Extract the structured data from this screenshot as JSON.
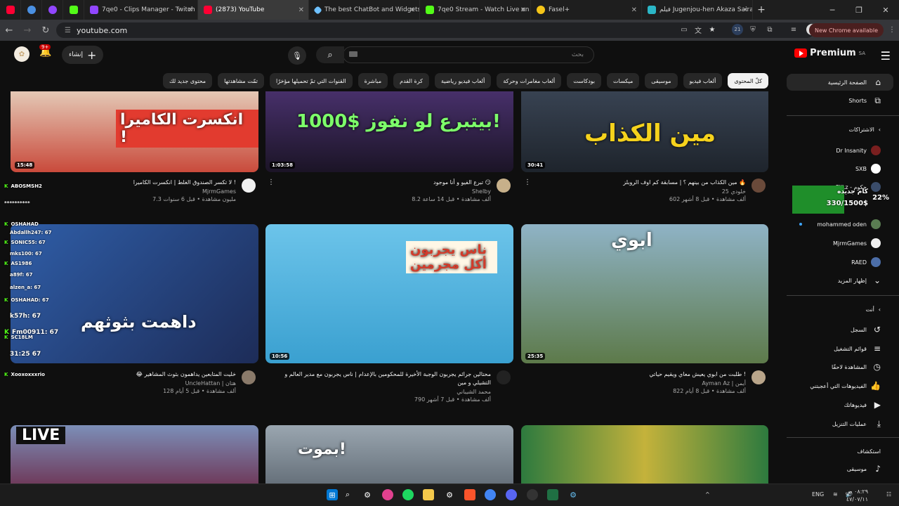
{
  "browser": {
    "tabs": [
      {
        "label": "",
        "icon": "youtube-icon",
        "color": "#ff0033"
      },
      {
        "label": "",
        "icon": "circle-icon",
        "color": "#4a90e2"
      },
      {
        "label": "",
        "icon": "twitch-icon",
        "color": "#9146ff"
      },
      {
        "label": "",
        "icon": "extension-icon",
        "color": "#53fc18"
      },
      {
        "label": "7qe0 - Clips Manager - Twitch",
        "icon": "twitch-icon",
        "color": "#9146ff"
      },
      {
        "label": "(2873) YouTube",
        "icon": "youtube-icon",
        "color": "#ff0033"
      },
      {
        "label": "The best ChatBot and Widgets",
        "icon": "diamond-icon",
        "color": "#6ec1ff"
      },
      {
        "label": "7qe0 Stream - Watch Live on Kick",
        "icon": "kick-icon",
        "color": "#53fc18"
      },
      {
        "label": "Fasel+",
        "icon": "lightbulb-icon",
        "color": "#f5c518"
      },
      {
        "label": "فيلم Jugenjou-hen Akaza Sairai",
        "icon": "play-icon",
        "color": "#2bb6c6"
      }
    ],
    "url": "youtube.com",
    "new_chrome": "New Chrome available",
    "ext_badge": "21"
  },
  "youtube": {
    "logo": "Premium",
    "region": "SA",
    "search_placeholder": "بحث",
    "create_label": "إنشاء",
    "notif_badge": "9+",
    "chips": [
      "كلّ المحتوى",
      "ألعاب فيديو",
      "موسيقى",
      "ميكسات",
      "بودكاست",
      "ألعاب مغامرات وحركة",
      "ألعاب فيديو رياضية",
      "كرة القدم",
      "مباشرة",
      "القنوات التي تمّ تحميلها مؤخرًا",
      "تمّت مشاهدتها",
      "محتوى جديد لك"
    ],
    "sidebar": {
      "home": "الصفحة الرئيسية",
      "shorts": "Shorts",
      "subs_header": "الاشتراكات",
      "subs": [
        {
          "name": "Dr Insanity",
          "color": "#7a1f1f"
        },
        {
          "name": "SXB",
          "color": "#ffffff"
        },
        {
          "name": "oPiiLz - حكوم",
          "color": "#3a4c6a"
        },
        {
          "name": "mohammed oden",
          "color": "#5a7d52"
        },
        {
          "name": "MjrmGames",
          "color": "#f1f1f1"
        },
        {
          "name": "RAED",
          "color": "#4c6ea8"
        }
      ],
      "show_more": "إظهار المزيد",
      "you_header": "أنت",
      "you": [
        {
          "label": "السجل",
          "icon": "history-icon"
        },
        {
          "label": "قوائم التشغيل",
          "icon": "playlist-icon"
        },
        {
          "label": "المشاهدة لاحقًا",
          "icon": "clock-icon"
        },
        {
          "label": "الفيديوهات التي أعجبتني",
          "icon": "thumbs-up-icon"
        },
        {
          "label": "فيديوهاتك",
          "icon": "video-icon"
        },
        {
          "label": "عمليات التنزيل",
          "icon": "download-icon"
        }
      ],
      "explore_header": "استكشاف",
      "explore": [
        {
          "label": "موسيقى",
          "icon": "music-icon"
        }
      ]
    },
    "videos": [
      {
        "title": "لا تكسر الصندوق الغلط | انكسرت الكاميرا !",
        "channel": "MjrmGames",
        "stats": "7.3 مليون مشاهدة • قبل 6 سنوات",
        "duration": "15:48",
        "thumb_text": "انكسرت الكاميرا !",
        "bg": "#c94a3b"
      },
      {
        "title": "تبرع الفيو و أنا موجود 😏",
        "channel": "Shelby",
        "stats": "8.2 ألف مشاهدة • قبل 14 ساعة",
        "duration": "1:03:58",
        "thumb_text": "1000$ بيتبرع لو نفوز!",
        "bg": "#3a2a55"
      },
      {
        "title": "مين الكذاب من بينهم ؟ | مسابقة كم اوف الروبلز 🔥",
        "channel": "خلودي 25",
        "stats": "602 ألف مشاهدة • قبل 8 أشهر",
        "duration": "30:41",
        "thumb_text": "مين الكذاب",
        "bg": "#2b3440"
      },
      {
        "title": "😂 خليت المتابعين يداهمون بثوث المشاهير",
        "channel": "UncleHattan | هتان",
        "stats": "128 ألف مشاهدة • قبل 5 أيام",
        "duration": "",
        "thumb_text": "داهمت بثوثهم",
        "bg": "#2f5ea8"
      },
      {
        "title": "محتالين جرائم يجربون الوجبة الأخيرة للمحكومين بالإعدام | ناس يجربون مع مدير العالم و التشيلي و مين",
        "channel": "محمد الشيباني",
        "stats": "790 ألف مشاهدة • قبل 7 أشهر",
        "duration": "10:56",
        "thumb_text": "ناس يجربون أكل مجرمين",
        "bg": "#5ab5e0"
      },
      {
        "title": "طلبت من ابوي يعيش معاي ويقيم حياتي !",
        "channel": "Ayman Az | أيمن",
        "stats": "822 ألف مشاهدة • قبل 8 أيام",
        "duration": "25:35",
        "thumb_text": "ابوي",
        "bg": "#5d7a4a"
      },
      {
        "title": "",
        "channel": "",
        "stats": "",
        "duration": "",
        "thumb_text": "LIVE",
        "bg": "#6c2b4a"
      },
      {
        "title": "",
        "channel": "",
        "stats": "",
        "duration": "",
        "thumb_text": "بموت!",
        "bg": "#6f7b86"
      },
      {
        "title": "",
        "channel": "",
        "stats": "",
        "duration": "",
        "thumb_text": "",
        "bg": "#2d7a3e"
      }
    ],
    "chat": [
      {
        "user": "ABOSMSH2",
        "msg": ""
      },
      {
        "user": "**********",
        "msg": ""
      },
      {
        "user": "OSHAHAD",
        "msg": ""
      },
      {
        "user": "Abdallh247:",
        "msg": "67"
      },
      {
        "user": "SONIC55:",
        "msg": "67"
      },
      {
        "user": "mks100:",
        "msg": "67"
      },
      {
        "user": "AS1986",
        "msg": ""
      },
      {
        "user": "a89f:",
        "msg": "67"
      },
      {
        "user": "alzen_a:",
        "msg": "67"
      },
      {
        "user": "OSHAHAD:",
        "msg": "67"
      },
      {
        "user": "k57h:",
        "msg": "67"
      },
      {
        "user": "Fm00911:",
        "msg": "67"
      },
      {
        "user": "SC18LM",
        "msg": ""
      },
      {
        "user": "31:25",
        "msg": "67"
      },
      {
        "user": "Xooxoxxxrio",
        "msg": ""
      }
    ],
    "goal": {
      "title": "كام جديده",
      "amount": "330/1500$",
      "percent": "22%"
    }
  },
  "taskbar": {
    "lang": "ENG",
    "time": "٠٨:٢٩ ص",
    "date": "٤٧/٠٧/١١"
  }
}
